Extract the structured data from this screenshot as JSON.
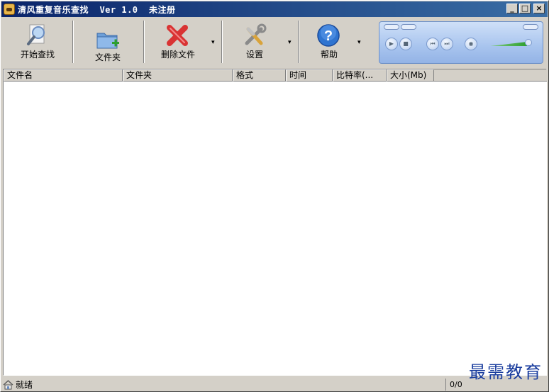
{
  "window": {
    "title": "清风重复音乐查找  Ver 1.0  未注册",
    "minimize_label": "_",
    "maximize_label": "□",
    "close_label": "×"
  },
  "toolbar": {
    "start_search_label": "开始查找",
    "folder_label": "文件夹",
    "delete_files_label": "删除文件",
    "settings_label": "设置",
    "help_label": "帮助",
    "dropdown_glyph": "▾"
  },
  "player": {
    "play_glyph": "▶",
    "stop_glyph": "■",
    "prev_glyph": "⏮",
    "next_glyph": "⏭",
    "mute_glyph": "◉"
  },
  "list": {
    "columns": [
      "文件名",
      "文件夹",
      "格式",
      "时间",
      "比特率(...",
      "大小(Mb)"
    ]
  },
  "status": {
    "text": "就绪",
    "count": "0/0"
  },
  "watermark": "最需教育"
}
